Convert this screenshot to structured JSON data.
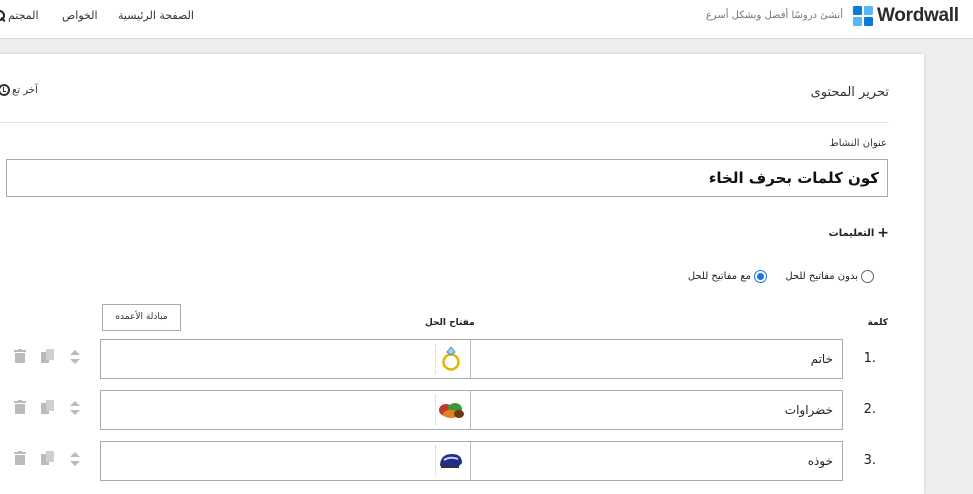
{
  "header": {
    "logo_text": "Wordwall",
    "tagline": "أنشئ دروسًا أفضل وبشكل أسرع",
    "nav": {
      "home": "الصفحة الرئيسية",
      "features": "الخواص",
      "community": "المجتم"
    }
  },
  "editor": {
    "title": "تحرير المحتوى",
    "last_edited": "آخر تع",
    "activity_title_label": "عنوان النشاط",
    "activity_title_value": "كون كلمات بحرف الخاء",
    "instructions_label": "التعليمات",
    "options": {
      "without_keys": "بدون مفاتيح للحل",
      "with_keys": "مع مفاتيح للحل",
      "selected": "with_keys"
    },
    "swap_columns_label": "مبادلة الأعمده",
    "columns": {
      "word": "كلمة",
      "answer_key": "مفتاح الحل"
    },
    "rows": [
      {
        "number": "1.",
        "word": "خاتم",
        "image": "ring"
      },
      {
        "number": "2.",
        "word": "خضراوات",
        "image": "vegetables"
      },
      {
        "number": "3.",
        "word": "خوذه",
        "image": "helmet"
      }
    ]
  },
  "colors": {
    "logo_blue": "#0a7bd9",
    "logo_light": "#5bb6f5",
    "radio_accent": "#1a73e8"
  }
}
